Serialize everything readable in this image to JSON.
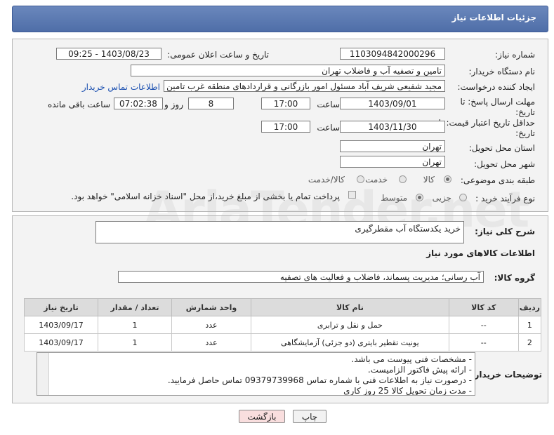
{
  "header": {
    "title": "جزئیات اطلاعات نیاز"
  },
  "need_number": {
    "label": "شماره نیاز:",
    "value": "1103094842000296"
  },
  "announce_datetime": {
    "label": "تاریخ و ساعت اعلان عمومی:",
    "value": "1403/08/23 - 09:25"
  },
  "buyer_org": {
    "label": "نام دستگاه خریدار:",
    "value": "تامین و تصفیه آب و فاضلاب تهران"
  },
  "requester": {
    "label": "ایجاد کننده درخواست:",
    "value": "مجید شفیعی شریف آباد مسئول امور بازرگانی و قراردادهای منطقه غرب تامین و",
    "contact_link": "اطلاعات تماس خریدار"
  },
  "reply_deadline": {
    "label": "مهلت ارسال پاسخ: تا تاریخ:",
    "date": "1403/09/01",
    "time_label": "ساعت",
    "time": "17:00",
    "days": "8",
    "days_label": "روز و",
    "remaining": "07:02:38",
    "remaining_label": "ساعت باقی مانده"
  },
  "price_validity": {
    "label": "حداقل تاریخ اعتبار قیمت: تا تاریخ:",
    "date": "1403/11/30",
    "time_label": "ساعت",
    "time": "17:00"
  },
  "delivery_province": {
    "label": "استان محل تحویل:",
    "value": "تهران"
  },
  "delivery_city": {
    "label": "شهر محل تحویل:",
    "value": "تهران"
  },
  "category": {
    "label": "طبقه بندی موضوعی:",
    "options": [
      "کالا",
      "خدمت",
      "کالا/خدمت"
    ],
    "selected": "کالا"
  },
  "purchase_type": {
    "label": "نوع فرآیند خرید :",
    "options": [
      "جزیی",
      "متوسط"
    ],
    "selected": "متوسط",
    "payment_note": "پرداخت تمام یا بخشی از مبلغ خرید،از محل \"اسناد خزانه اسلامی\" خواهد بود."
  },
  "description": {
    "label": "شرح کلی نیاز:",
    "value": "خرید یکدستگاه آب مقطرگیری"
  },
  "goods_section_title": "اطلاعات کالاهای مورد نیاز",
  "goods_group": {
    "label": "گروه کالا:",
    "value": "آب رسانی؛ مدیریت پسماند، فاضلاب و فعالیت های تصفیه"
  },
  "table": {
    "headers": [
      "ردیف",
      "کد کالا",
      "نام کالا",
      "واحد شمارش",
      "تعداد / مقدار",
      "تاریخ نیاز"
    ],
    "rows": [
      [
        "1",
        "--",
        "حمل و نقل و ترابری",
        "عدد",
        "1",
        "1403/09/17"
      ],
      [
        "2",
        "--",
        "یونیت تقطیر بایتری (دو جزئی) آزمایشگاهی",
        "عدد",
        "1",
        "1403/09/17"
      ]
    ]
  },
  "buyer_notes": {
    "label": "توضیحات خریدار:",
    "lines": [
      "- مشخصات فنی پیوست می باشد.",
      "- ارائه پیش فاکتور الزامیست.",
      "- درصورت نیاز به اطلاعات فنی با شماره تماس 09379739968 تماس حاصل فرمایید.",
      "- مدت زمان تحویل کالا 25 روز کاری"
    ]
  },
  "buttons": {
    "print": "چاپ",
    "back": "بازگشت"
  },
  "colors": {
    "header": "#4f6ea8",
    "link": "#1a4fb0",
    "back_button_bg": "#f9dede"
  }
}
